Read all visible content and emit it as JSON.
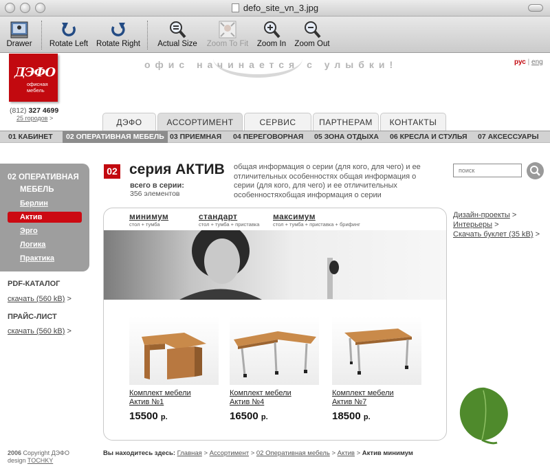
{
  "window": {
    "title": "defo_site_vn_3.jpg"
  },
  "toolbar": {
    "drawer": "Drawer",
    "rotate_left": "Rotate Left",
    "rotate_right": "Rotate Right",
    "actual_size": "Actual Size",
    "zoom_to_fit": "Zoom To Fit",
    "zoom_in": "Zoom In",
    "zoom_out": "Zoom Out"
  },
  "site": {
    "logo": {
      "main": "ДЭФО",
      "sub1": "офисная",
      "sub2": "мебель"
    },
    "phone_code": "(812)",
    "phone_number": "327 4699",
    "cities": "25 городов",
    "cities_arrow": ">",
    "slogan": "офис начинается с улыбки!",
    "lang": {
      "rus": "рус",
      "sep": "|",
      "eng": "eng"
    },
    "main_tabs": [
      "ДЭФО",
      "АССОРТИМЕНТ",
      "СЕРВИС",
      "ПАРТНЕРАМ",
      "КОНТАКТЫ"
    ],
    "sub_nav": [
      "01 КАБИНЕТ",
      "02 ОПЕРАТИВНАЯ МЕБЕЛЬ",
      "03 ПРИЕМНАЯ",
      "04 ПЕРЕГОВОРНАЯ",
      "05 ЗОНА ОТДЫХА",
      "06 КРЕСЛА И СТУЛЬЯ",
      "07 АКСЕССУАРЫ"
    ],
    "left_menu": {
      "title_line1": "02 ОПЕРАТИВНАЯ",
      "title_line2": "МЕБЕЛЬ",
      "items": [
        "Берлин",
        "Актив",
        "Эрго",
        "Логика",
        "Практика"
      ]
    },
    "pdf_catalog": {
      "title": "PDF-КАТАЛОГ",
      "link": "скачать (560 kB)",
      "arrow": ">"
    },
    "price_list": {
      "title": "ПРАЙС-ЛИСТ",
      "link": "скачать (560 kB)",
      "arrow": ">"
    },
    "series": {
      "number": "02",
      "title": "серия АКТИВ",
      "count_label": "всего в серии:",
      "count": "356 элементов",
      "description": "общая информация о серии (для кого, для чего) и ее отличительных особенностях общая информация о серии (для кого, для чего) и ее отличительных особенностяхобщая информация о серии"
    },
    "search": {
      "placeholder": "поиск"
    },
    "configs": [
      {
        "name": "минимум",
        "sub": "стол + тумба"
      },
      {
        "name": "стандарт",
        "sub": "стол + тумба + приставка"
      },
      {
        "name": "максимум",
        "sub": "стол + тумба + приставка + брифинг"
      }
    ],
    "products": [
      {
        "name1": "Комплект мебели",
        "name2": "Актив №1",
        "price": "15500",
        "currency": "р."
      },
      {
        "name1": "Комплект мебели",
        "name2": "Актив №4",
        "price": "16500",
        "currency": "р."
      },
      {
        "name1": "Комплект мебели",
        "name2": "Актив №7",
        "price": "18500",
        "currency": "р."
      }
    ],
    "right_links": [
      {
        "text": "Дизайн-проекты",
        "arrow": ">"
      },
      {
        "text": "Интерьеры",
        "arrow": ">"
      },
      {
        "text": "Скачать буклет (35 kB)",
        "arrow": ">"
      }
    ],
    "breadcrumb": {
      "label": "Вы находитесь здесь:",
      "items": [
        "Главная",
        "Ассортимент",
        "02 Оперативная мебель",
        "Актив"
      ],
      "sep": ">",
      "current": "Актив минимум"
    },
    "footer": {
      "year": "2006",
      "copyright": "Copyright ДЭФО",
      "design_label": "design",
      "design_link": "TOCHKY"
    }
  },
  "colors": {
    "brand_red": "#c2090f",
    "menu_gray": "#9e9e9e"
  }
}
